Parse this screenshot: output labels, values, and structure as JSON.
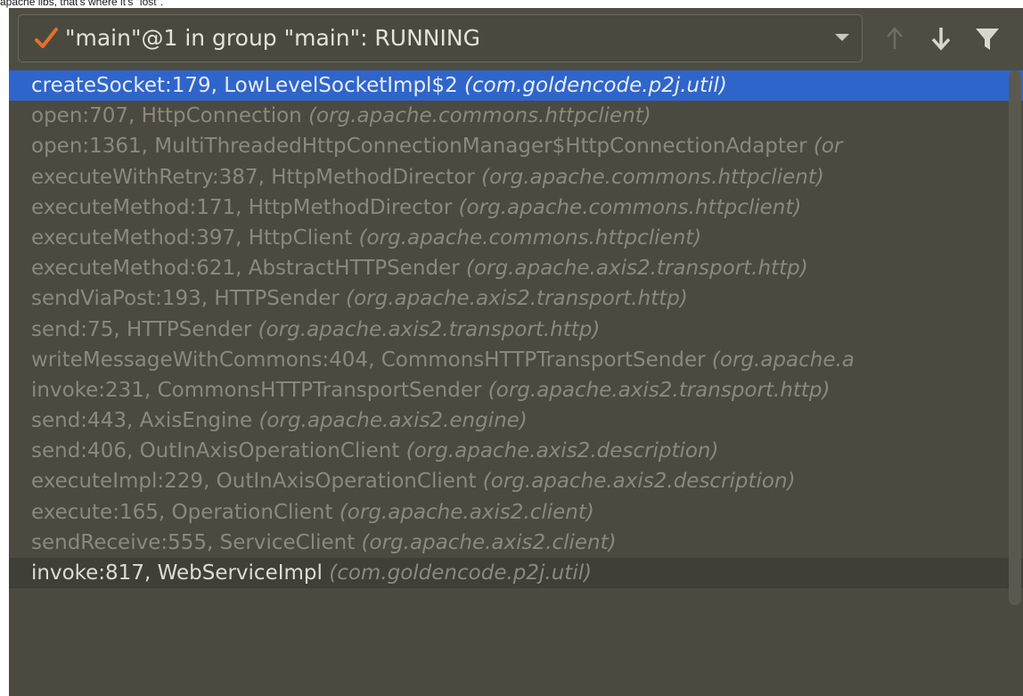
{
  "caption": "apache libs, that's where it's \"lost\".",
  "toolbar": {
    "thread_label": "\"main\"@1 in group \"main\": RUNNING",
    "icons": [
      "check-icon",
      "dropdown-icon",
      "arrow-up-icon",
      "arrow-down-icon",
      "filter-icon"
    ]
  },
  "frames": [
    {
      "method": "createSocket:179, LowLevelSocketImpl$2",
      "package": "(com.goldencode.p2j.util)"
    },
    {
      "method": "open:707, HttpConnection",
      "package": "(org.apache.commons.httpclient)"
    },
    {
      "method": "open:1361, MultiThreadedHttpConnectionManager$HttpConnectionAdapter",
      "package": "(or"
    },
    {
      "method": "executeWithRetry:387, HttpMethodDirector",
      "package": "(org.apache.commons.httpclient)"
    },
    {
      "method": "executeMethod:171, HttpMethodDirector",
      "package": "(org.apache.commons.httpclient)"
    },
    {
      "method": "executeMethod:397, HttpClient",
      "package": "(org.apache.commons.httpclient)"
    },
    {
      "method": "executeMethod:621, AbstractHTTPSender",
      "package": "(org.apache.axis2.transport.http)"
    },
    {
      "method": "sendViaPost:193, HTTPSender",
      "package": "(org.apache.axis2.transport.http)"
    },
    {
      "method": "send:75, HTTPSender",
      "package": "(org.apache.axis2.transport.http)"
    },
    {
      "method": "writeMessageWithCommons:404, CommonsHTTPTransportSender",
      "package": "(org.apache.a"
    },
    {
      "method": "invoke:231, CommonsHTTPTransportSender",
      "package": "(org.apache.axis2.transport.http)"
    },
    {
      "method": "send:443, AxisEngine",
      "package": "(org.apache.axis2.engine)"
    },
    {
      "method": "send:406, OutInAxisOperationClient",
      "package": "(org.apache.axis2.description)"
    },
    {
      "method": "executeImpl:229, OutInAxisOperationClient",
      "package": "(org.apache.axis2.description)"
    },
    {
      "method": "execute:165, OperationClient",
      "package": "(org.apache.axis2.client)"
    },
    {
      "method": "sendReceive:555, ServiceClient",
      "package": "(org.apache.axis2.client)"
    },
    {
      "method": "invoke:817, WebServiceImpl",
      "package": "(com.goldencode.p2j.util)"
    }
  ],
  "colors": {
    "panel_bg": "#4b4a40",
    "selected_bg": "#2f65ca",
    "check": "#e4702a",
    "frame_text": "#8a897d"
  }
}
